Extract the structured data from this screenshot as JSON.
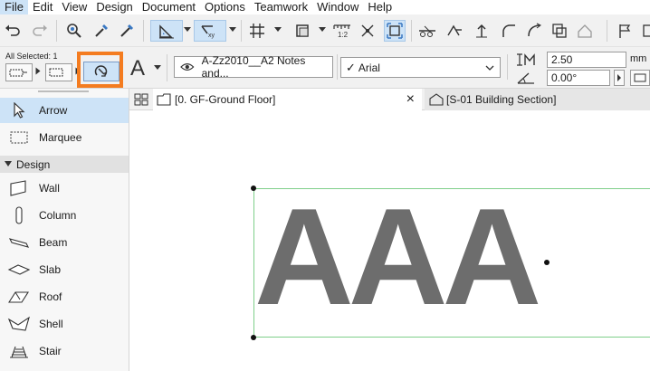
{
  "menu": {
    "items": [
      "File",
      "Edit",
      "View",
      "Design",
      "Document",
      "Options",
      "Teamwork",
      "Window",
      "Help"
    ]
  },
  "infobox": {
    "all_selected": "All Selected: 1",
    "layer": "A-Zz2010__A2 Notes and...",
    "font": "Arial",
    "font_check": "✓",
    "size_value": "2.50",
    "size_unit": "mm",
    "angle_value": "0.00°",
    "text_tool_glyph": "A"
  },
  "toolbox": {
    "tools_top": [
      {
        "label": "Arrow",
        "icon": "arrow-icon",
        "selected": true
      },
      {
        "label": "Marquee",
        "icon": "marquee-icon",
        "selected": false
      }
    ],
    "group": "Design",
    "design_tools": [
      {
        "label": "Wall",
        "icon": "wall-icon"
      },
      {
        "label": "Column",
        "icon": "column-icon"
      },
      {
        "label": "Beam",
        "icon": "beam-icon"
      },
      {
        "label": "Slab",
        "icon": "slab-icon"
      },
      {
        "label": "Roof",
        "icon": "roof-icon"
      },
      {
        "label": "Shell",
        "icon": "shell-icon"
      },
      {
        "label": "Stair",
        "icon": "stair-icon"
      }
    ]
  },
  "tabs": [
    {
      "label": "[0. GF-Ground Floor]",
      "active": true,
      "close": "×"
    },
    {
      "label": "[S-01 Building Section]",
      "active": false
    }
  ],
  "canvas": {
    "text": "AAA"
  },
  "colors": {
    "accent_selection": "#cde3f7",
    "highlight_orange": "#f47c20",
    "selection_green": "#7fcf8a",
    "text_gray": "#6d6d6d"
  }
}
